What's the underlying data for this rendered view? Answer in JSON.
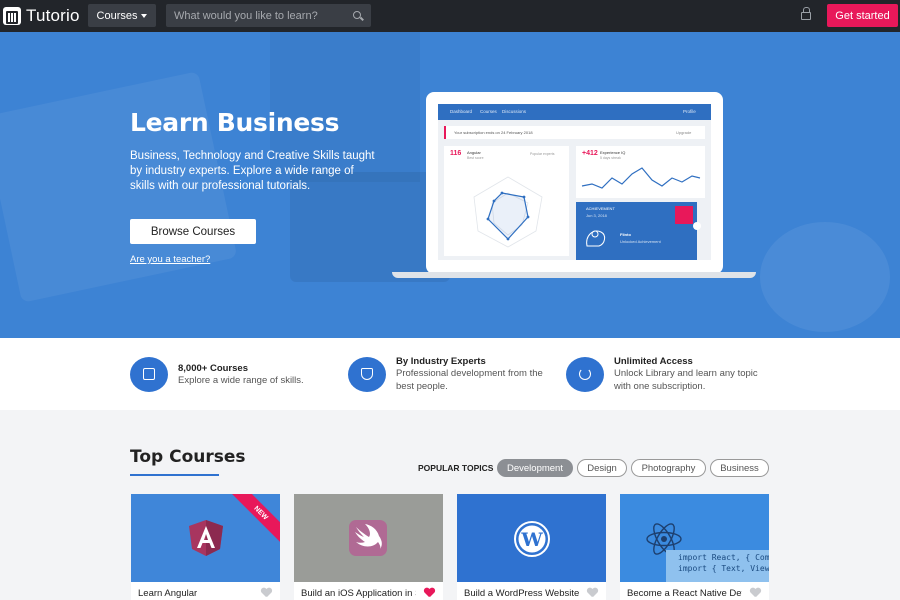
{
  "navbar": {
    "brand": "Tutorio",
    "courses_label": "Courses",
    "search_placeholder": "What would you like to learn?",
    "cta_label": "Get started",
    "brand_color": "#e8185a"
  },
  "hero": {
    "title": "Learn Business",
    "description": "Business, Technology and Creative Skills taught by industry experts. Explore a wide range of skills with our professional tutorials.",
    "browse_label": "Browse Courses",
    "teacher_link": "Are you a teacher?",
    "background_color": "#3d83d4"
  },
  "dashboard_preview": {
    "tabs": [
      "Dashboard",
      "Courses",
      "Discussions"
    ],
    "profile": "Profile",
    "subscription_note": "Your subscription ends on 24 February 2018",
    "upgrade": "Upgrade",
    "angular_count": "116",
    "angular_label": "Angular",
    "angular_sub": "Best score",
    "popular_label": "Popular experts",
    "experience_count": "+412",
    "experience_label": "Experience IQ",
    "experience_sub": "5 days streak",
    "achievement": "ACHIEVEMENT",
    "achievement_date": "Jun 3, 2018",
    "flinto": "Flinto",
    "flinto_sub": "Unlocked Achievement"
  },
  "features": [
    {
      "title": "8,000+ Courses",
      "text": "Explore a wide range of skills.",
      "icon": "courses-icon"
    },
    {
      "title": "By Industry Experts",
      "text": "Professional development from the best people.",
      "icon": "shield-icon"
    },
    {
      "title": "Unlimited Access",
      "text": "Unlock Library and learn any topic with one subscription.",
      "icon": "refresh-icon"
    }
  ],
  "top_courses": {
    "title": "Top Courses",
    "popular_topics_label": "POPULAR TOPICS",
    "topics": [
      "Development",
      "Design",
      "Photography",
      "Business"
    ],
    "active_topic": "Development"
  },
  "courses": [
    {
      "title": "Learn Angular",
      "badge": "NEW",
      "favorite": false,
      "icon": "angular-icon"
    },
    {
      "title": "Build an iOS Application in Swift",
      "favorite": true,
      "icon": "swift-icon"
    },
    {
      "title": "Build a WordPress Website",
      "favorite": false,
      "icon": "wordpress-icon"
    },
    {
      "title": "Become a React Native Developer",
      "favorite": false,
      "icon": "react-icon",
      "code_lines": [
        "import React, { Comp",
        "import { Text, View"
      ]
    }
  ]
}
